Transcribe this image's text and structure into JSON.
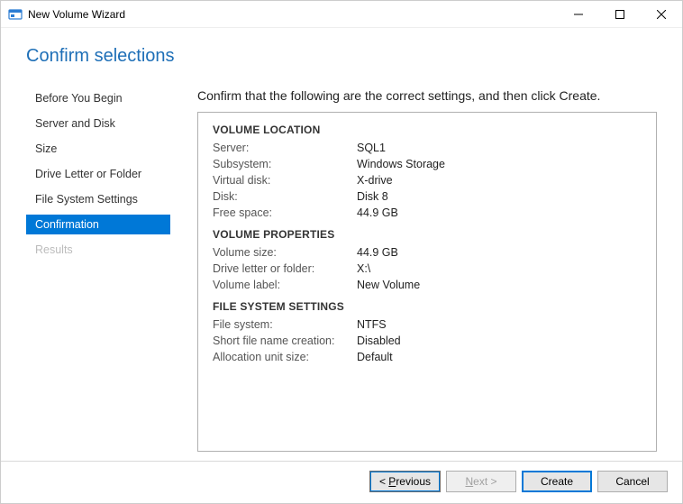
{
  "window": {
    "title": "New Volume Wizard"
  },
  "page_title": "Confirm selections",
  "nav": {
    "items": [
      {
        "label": "Before You Begin",
        "state": "normal"
      },
      {
        "label": "Server and Disk",
        "state": "normal"
      },
      {
        "label": "Size",
        "state": "normal"
      },
      {
        "label": "Drive Letter or Folder",
        "state": "normal"
      },
      {
        "label": "File System Settings",
        "state": "normal"
      },
      {
        "label": "Confirmation",
        "state": "active"
      },
      {
        "label": "Results",
        "state": "disabled"
      }
    ]
  },
  "main": {
    "instruction": "Confirm that the following are the correct settings, and then click Create.",
    "sections": [
      {
        "title": "VOLUME LOCATION",
        "rows": [
          {
            "k": "Server:",
            "v": "SQL1"
          },
          {
            "k": "Subsystem:",
            "v": "Windows Storage"
          },
          {
            "k": "Virtual disk:",
            "v": "X-drive"
          },
          {
            "k": "Disk:",
            "v": "Disk 8"
          },
          {
            "k": "Free space:",
            "v": "44.9 GB"
          }
        ]
      },
      {
        "title": "VOLUME PROPERTIES",
        "rows": [
          {
            "k": "Volume size:",
            "v": "44.9 GB"
          },
          {
            "k": "Drive letter or folder:",
            "v": "X:\\"
          },
          {
            "k": "Volume label:",
            "v": "New Volume"
          }
        ]
      },
      {
        "title": "FILE SYSTEM SETTINGS",
        "rows": [
          {
            "k": "File system:",
            "v": "NTFS"
          },
          {
            "k": "Short file name creation:",
            "v": "Disabled"
          },
          {
            "k": "Allocation unit size:",
            "v": "Default"
          }
        ]
      }
    ]
  },
  "footer": {
    "previous_prefix": "< ",
    "previous_u": "P",
    "previous_rest": "revious",
    "next_u": "N",
    "next_rest": "ext >",
    "create": "Create",
    "cancel": "Cancel"
  }
}
